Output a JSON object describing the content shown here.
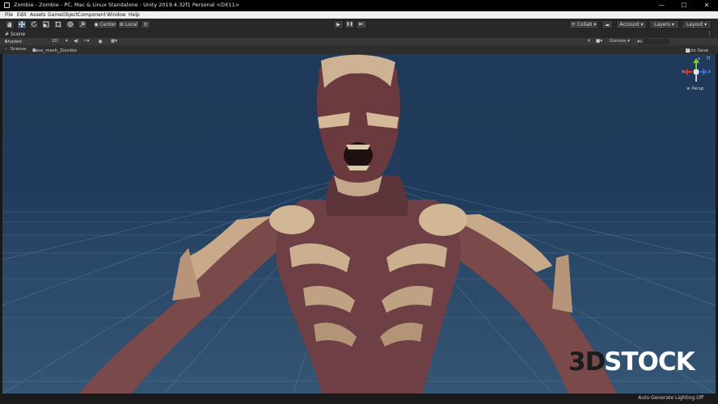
{
  "window": {
    "title": "Zombie - Zombie - PC, Mac & Linux Standalone - Unity 2019.4.32f1 Personal <DX11>",
    "minimize_glyph": "—",
    "maximize_glyph": "☐",
    "close_glyph": "✕"
  },
  "menu": [
    "File",
    "Edit",
    "Assets",
    "GameObject",
    "Component",
    "Window",
    "Help"
  ],
  "toolbar": {
    "tools": [
      "hand-tool-icon",
      "move-tool-icon",
      "rotate-tool-icon",
      "scale-tool-icon",
      "rect-tool-icon",
      "transform-tool-icon",
      "custom-tool-icon"
    ],
    "pivot_label": "Center",
    "space_label": "Local",
    "play_icon": "▶",
    "pause_icon": "❚❚",
    "step_icon": "▶|",
    "collab_label": "Collab ▾",
    "account_label": "Account ▾",
    "layers_label": "Layers ▾",
    "layout_label": "Layout ▾"
  },
  "scene_panel": {
    "tab_label": "Scene",
    "shading_mode": "Shaded",
    "mode_2d": "2D",
    "fx_count": "0",
    "gizmos_label": "Gizmos ▾",
    "search_placeholder": "All",
    "scenes_label": "Scenes",
    "asset_name": "Base_mesh_Zombie",
    "auto_save_label": "Auto Save",
    "auto_save_checked": true,
    "projection_label": "≡ Persp",
    "gizmo_axes": [
      "x",
      "y",
      "z"
    ]
  },
  "status": {
    "message": "Auto Generate Lighting Off"
  },
  "watermark": {
    "prefix": "3D",
    "suffix": "STOCK",
    "prefix_color": "#1b1b1b",
    "suffix_color": "#ffffff"
  },
  "colors": {
    "viewport_sky": "#1f3a5a",
    "grid": "#6f8eae",
    "gizmo_x": "#d03a2a",
    "gizmo_y": "#7acc2a",
    "gizmo_z": "#3a6ad0"
  }
}
